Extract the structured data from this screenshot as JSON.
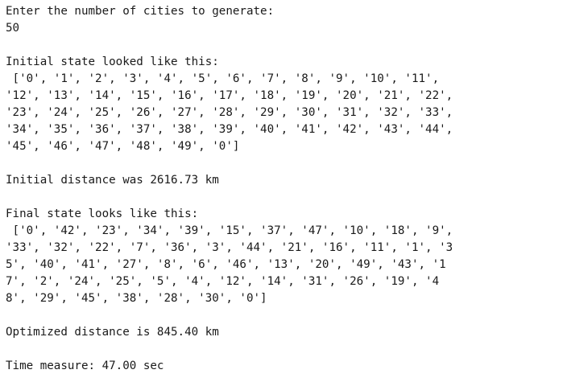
{
  "console": {
    "lines": [
      "Enter the number of cities to generate:",
      "50",
      "",
      "Initial state looked like this:",
      " ['0', '1', '2', '3', '4', '5', '6', '7', '8', '9', '10', '11',",
      "'12', '13', '14', '15', '16', '17', '18', '19', '20', '21', '22',",
      "'23', '24', '25', '26', '27', '28', '29', '30', '31', '32', '33',",
      "'34', '35', '36', '37', '38', '39', '40', '41', '42', '43', '44',",
      "'45', '46', '47', '48', '49', '0']",
      "",
      "Initial distance was 2616.73 km",
      "",
      "Final state looks like this:",
      " ['0', '42', '23', '34', '39', '15', '37', '47', '10', '18', '9',",
      "'33', '32', '22', '7', '36', '3', '44', '21', '16', '11', '1', '3",
      "5', '40', '41', '27', '8', '6', '46', '13', '20', '49', '43', '1",
      "7', '2', '24', '25', '5', '4', '12', '14', '31', '26', '19', '4",
      "8', '29', '45', '38', '28', '30', '0']",
      "",
      "Optimized distance is 845.40 km",
      "",
      "Time measure: 47.00 sec"
    ]
  }
}
